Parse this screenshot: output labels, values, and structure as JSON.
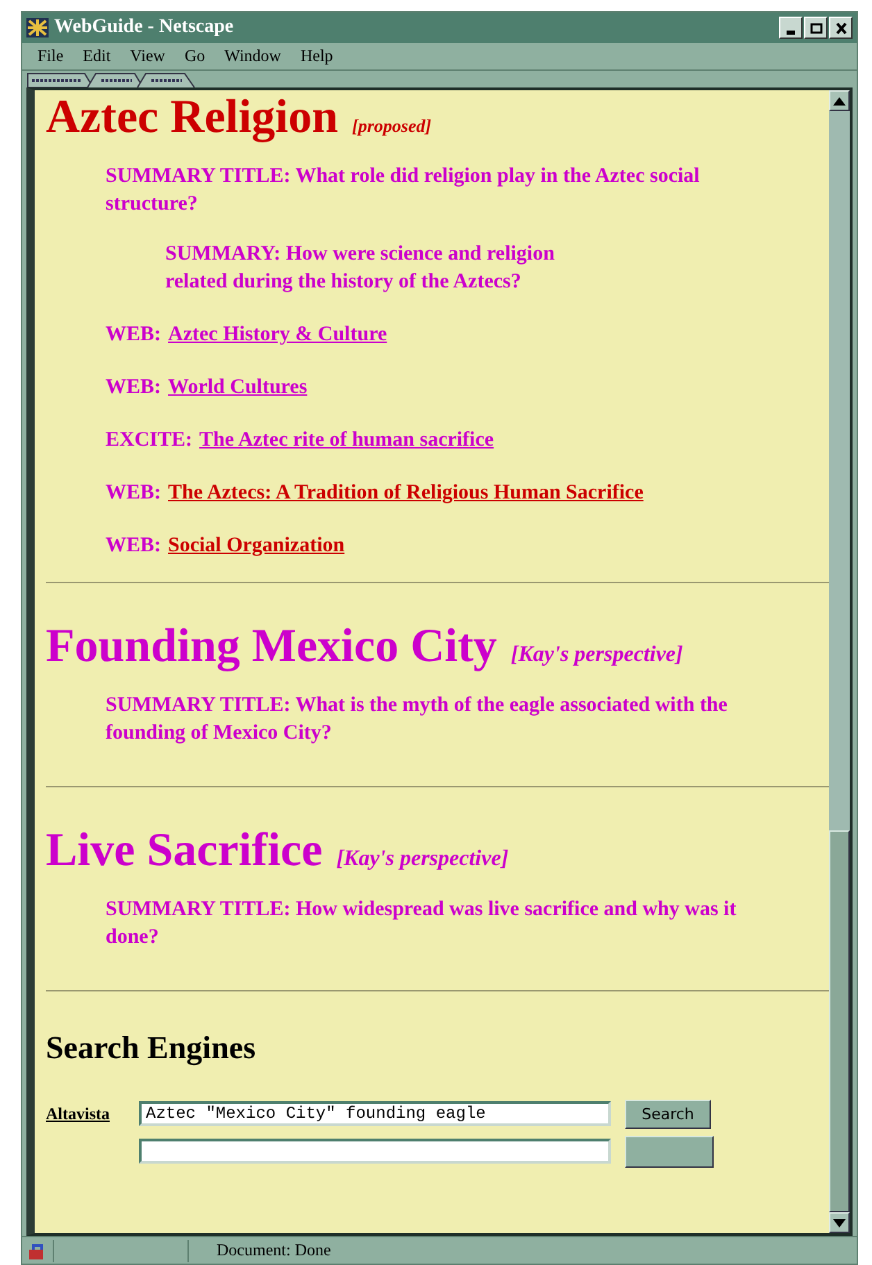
{
  "window": {
    "title": "WebGuide - Netscape"
  },
  "menu": [
    "File",
    "Edit",
    "View",
    "Go",
    "Window",
    "Help"
  ],
  "sections": [
    {
      "title": "Aztec Religion",
      "tag": "[proposed]",
      "color": "#cc0000",
      "items": [
        {
          "kind": "summary_title",
          "text": "SUMMARY TITLE: What role did religion play in the Aztec social structure?"
        },
        {
          "kind": "summary",
          "text": "SUMMARY: How were science and religion related during the history of the Aztecs?"
        },
        {
          "kind": "link",
          "prefix": "WEB:",
          "link": "Aztec History & Culture",
          "visited": false
        },
        {
          "kind": "link",
          "prefix": "WEB:",
          "link": "World Cultures",
          "visited": false
        },
        {
          "kind": "link",
          "prefix": "EXCITE:",
          "link": "The Aztec rite of human sacrifice",
          "visited": false
        },
        {
          "kind": "link",
          "prefix": "WEB:",
          "link": "The Aztecs: A Tradition of Religious Human Sacrifice",
          "visited": true
        },
        {
          "kind": "link",
          "prefix": "WEB:",
          "link": "Social Organization",
          "visited": true
        }
      ]
    },
    {
      "title": "Founding Mexico City",
      "tag": "[Kay's perspective]",
      "color": "#cc00cc",
      "items": [
        {
          "kind": "summary_title",
          "text": "SUMMARY TITLE: What is the myth of the eagle associated with the founding of Mexico City?"
        }
      ]
    },
    {
      "title": "Live Sacrifice",
      "tag": "[Kay's perspective]",
      "color": "#cc00cc",
      "items": [
        {
          "kind": "summary_title",
          "text": "SUMMARY TITLE: How widespread was live sacrifice and why was it done?"
        }
      ]
    }
  ],
  "search": {
    "heading": "Search Engines",
    "engines": [
      {
        "label": "Altavista",
        "value": "Aztec \"Mexico City\" founding eagle",
        "button": "Search"
      }
    ]
  },
  "status_bar": {
    "text": "Document: Done"
  }
}
